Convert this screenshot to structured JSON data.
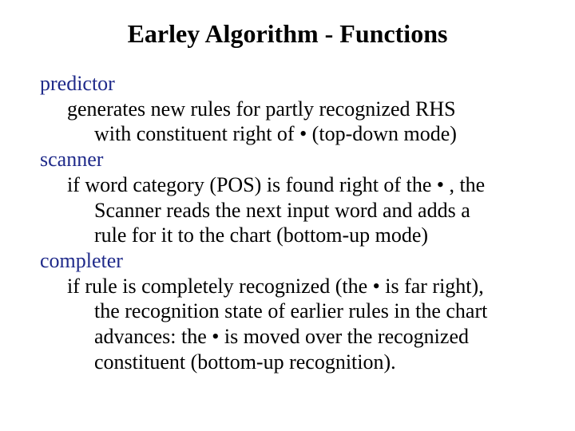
{
  "title": "Earley Algorithm - Functions",
  "predictor": {
    "term": "predictor",
    "line1": "generates new rules for partly recognized RHS",
    "line2": "with constituent right of • (top-down mode)"
  },
  "scanner": {
    "term": "scanner",
    "line1": "if word category (POS) is found right of the • , the",
    "line2": "Scanner reads the next input word and adds a",
    "line3": "rule for it to the chart (bottom-up mode)"
  },
  "completer": {
    "term": "completer",
    "line1": "if rule is completely recognized (the • is far right),",
    "line2": "the recognition state of earlier rules in the chart",
    "line3": "advances: the • is moved over the recognized",
    "line4": "constituent (bottom-up recognition)."
  }
}
